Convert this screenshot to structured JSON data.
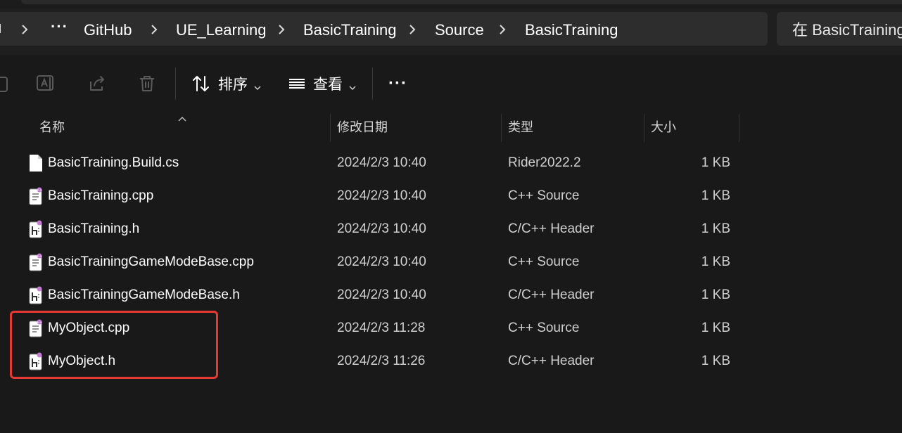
{
  "breadcrumb": {
    "items": [
      "GitHub",
      "UE_Learning",
      "BasicTraining",
      "Source",
      "BasicTraining"
    ],
    "overflow": "···"
  },
  "search": {
    "placeholder": "在 BasicTraining"
  },
  "toolbar": {
    "sort_label": "排序",
    "view_label": "查看",
    "more_label": "···"
  },
  "columns": {
    "name": "名称",
    "date": "修改日期",
    "type": "类型",
    "size": "大小"
  },
  "files": [
    {
      "name": "BasicTraining.Build.cs",
      "date": "2024/2/3 10:40",
      "type": "Rider2022.2",
      "size": "1 KB",
      "icon": "generic-file-icon"
    },
    {
      "name": "BasicTraining.cpp",
      "date": "2024/2/3 10:40",
      "type": "C++ Source",
      "size": "1 KB",
      "icon": "cpp-file-icon"
    },
    {
      "name": "BasicTraining.h",
      "date": "2024/2/3 10:40",
      "type": "C/C++ Header",
      "size": "1 KB",
      "icon": "header-file-icon"
    },
    {
      "name": "BasicTrainingGameModeBase.cpp",
      "date": "2024/2/3 10:40",
      "type": "C++ Source",
      "size": "1 KB",
      "icon": "cpp-file-icon"
    },
    {
      "name": "BasicTrainingGameModeBase.h",
      "date": "2024/2/3 10:40",
      "type": "C/C++ Header",
      "size": "1 KB",
      "icon": "header-file-icon"
    },
    {
      "name": "MyObject.cpp",
      "date": "2024/2/3 11:28",
      "type": "C++ Source",
      "size": "1 KB",
      "icon": "cpp-file-icon"
    },
    {
      "name": "MyObject.h",
      "date": "2024/2/3 11:26",
      "type": "C/C++ Header",
      "size": "1 KB",
      "icon": "header-file-icon"
    }
  ],
  "colors": {
    "background": "#191919",
    "highlight": "#e53935",
    "file_badge": "#c77dd6"
  }
}
